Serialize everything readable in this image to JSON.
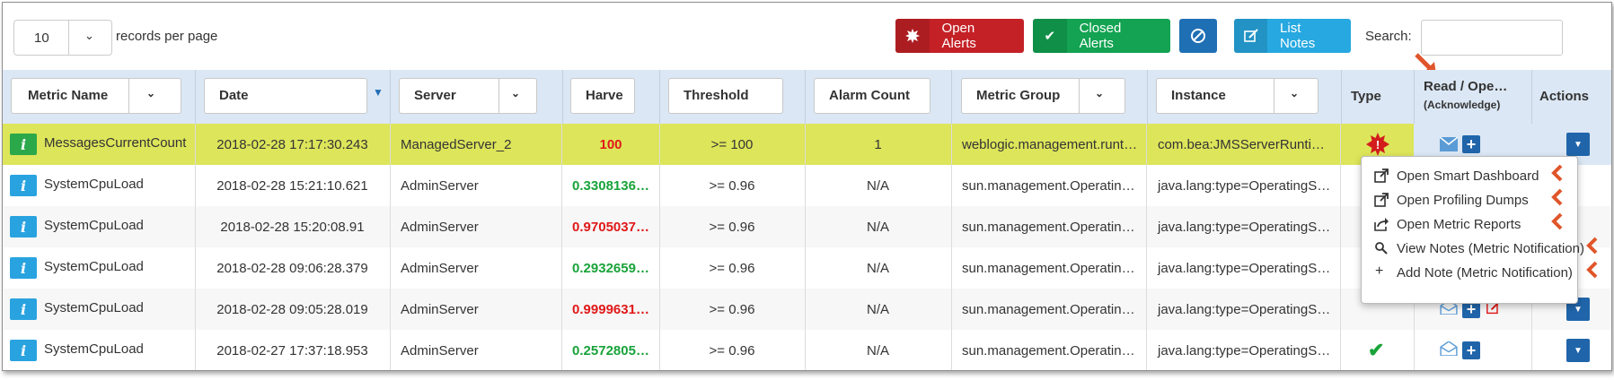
{
  "toolbar": {
    "page_length": "10",
    "page_length_label": "records per page",
    "open_alerts": "Open Alerts",
    "closed_alerts": "Closed Alerts",
    "list_notes": "List Notes",
    "search_label": "Search:",
    "search_value": ""
  },
  "columns": {
    "metric_name": "Metric Name",
    "date": "Date",
    "server": "Server",
    "harvested": "Harve",
    "threshold": "Threshold",
    "alarm_count": "Alarm Count",
    "metric_group": "Metric Group",
    "instance": "Instance",
    "type": "Type",
    "read": "Read / Ope…",
    "read_sub": "(Acknowledge)",
    "actions": "Actions"
  },
  "rows": [
    {
      "metric": "MessagesCurrentCount",
      "date": "2018-02-28 17:17:30.243",
      "server": "ManagedServer_2",
      "harvested": "100",
      "threshold": ">= 100",
      "alarm_count": "1",
      "group": "weblogic.management.runt…",
      "instance": "com.bea:JMSServerRunti…"
    },
    {
      "metric": "SystemCpuLoad",
      "date": "2018-02-28 15:21:10.621",
      "server": "AdminServer",
      "harvested": "0.3308136…",
      "threshold": ">= 0.96",
      "alarm_count": "N/A",
      "group": "sun.management.Operatin…",
      "instance": "java.lang:type=OperatingS…"
    },
    {
      "metric": "SystemCpuLoad",
      "date": "2018-02-28 15:20:08.91",
      "server": "AdminServer",
      "harvested": "0.9705037…",
      "threshold": ">= 0.96",
      "alarm_count": "N/A",
      "group": "sun.management.Operatin…",
      "instance": "java.lang:type=OperatingS…"
    },
    {
      "metric": "SystemCpuLoad",
      "date": "2018-02-28 09:06:28.379",
      "server": "AdminServer",
      "harvested": "0.2932659…",
      "threshold": ">= 0.96",
      "alarm_count": "N/A",
      "group": "sun.management.Operatin…",
      "instance": "java.lang:type=OperatingS…"
    },
    {
      "metric": "SystemCpuLoad",
      "date": "2018-02-28 09:05:28.019",
      "server": "AdminServer",
      "harvested": "0.9999631…",
      "threshold": ">= 0.96",
      "alarm_count": "N/A",
      "group": "sun.management.Operatin…",
      "instance": "java.lang:type=OperatingS…"
    },
    {
      "metric": "SystemCpuLoad",
      "date": "2018-02-27 17:37:18.953",
      "server": "AdminServer",
      "harvested": "0.2572805…",
      "threshold": ">= 0.96",
      "alarm_count": "N/A",
      "group": "sun.management.Operatin…",
      "instance": "java.lang:type=OperatingS…"
    }
  ],
  "menu": [
    {
      "label": "Open Smart Dashboard",
      "icon": "external-link-icon"
    },
    {
      "label": "Open Profiling Dumps",
      "icon": "external-link-icon"
    },
    {
      "label": "Open Metric Reports",
      "icon": "share-icon"
    },
    {
      "label": "View Notes (Metric Notification)",
      "icon": "search-icon"
    },
    {
      "label": "Add Note (Metric Notification)",
      "icon": "plus-icon"
    }
  ],
  "colors": {
    "highlight_row": "#dde55a",
    "header_bg": "#dbe7f4",
    "alarm_red": "#e01818",
    "ok_green": "#19a33a",
    "annotation": "#e0562b",
    "action_blue": "#2065aa",
    "info_green": "#2aa84a",
    "info_blue": "#29a3e0"
  }
}
